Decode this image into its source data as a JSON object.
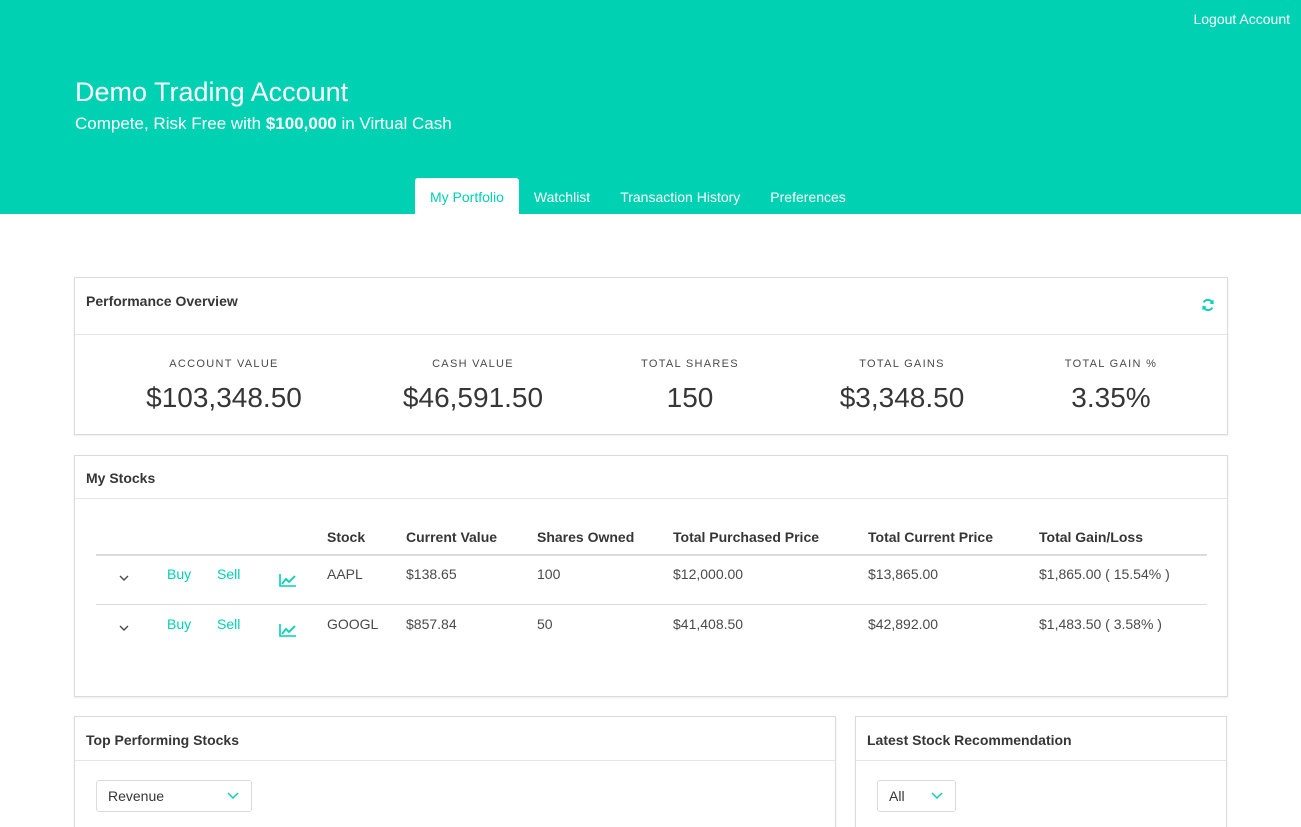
{
  "header": {
    "logout": "Logout Account",
    "title": "Demo Trading Account",
    "subtitle_pre": "Compete, Risk Free with ",
    "subtitle_amount": "$100,000",
    "subtitle_post": " in Virtual Cash",
    "accent_color": "#00d1b2"
  },
  "tabs": [
    {
      "label": "My Portfolio",
      "active": true
    },
    {
      "label": "Watchlist",
      "active": false
    },
    {
      "label": "Transaction History",
      "active": false
    },
    {
      "label": "Preferences",
      "active": false
    }
  ],
  "performance": {
    "title": "Performance Overview",
    "refresh_icon": "refresh-icon",
    "stats": [
      {
        "label": "ACCOUNT VALUE",
        "value": "$103,348.50"
      },
      {
        "label": "CASH VALUE",
        "value": "$46,591.50"
      },
      {
        "label": "TOTAL SHARES",
        "value": "150"
      },
      {
        "label": "TOTAL GAINS",
        "value": "$3,348.50"
      },
      {
        "label": "TOTAL GAIN %",
        "value": "3.35%"
      }
    ]
  },
  "stocks": {
    "title": "My Stocks",
    "columns": [
      "Stock",
      "Current Value",
      "Shares Owned",
      "Total Purchased Price",
      "Total Current Price",
      "Total Gain/Loss"
    ],
    "buy_label": "Buy",
    "sell_label": "Sell",
    "rows": [
      {
        "stock": "AAPL",
        "current_value": "$138.65",
        "shares": "100",
        "purchased": "$12,000.00",
        "current_total": "$13,865.00",
        "gain": "$1,865.00 ( 15.54% )"
      },
      {
        "stock": "GOOGL",
        "current_value": "$857.84",
        "shares": "50",
        "purchased": "$41,408.50",
        "current_total": "$42,892.00",
        "gain": "$1,483.50 ( 3.58% )"
      }
    ]
  },
  "top_performing": {
    "title": "Top Performing Stocks",
    "select_value": "Revenue"
  },
  "recommendation": {
    "title": "Latest Stock Recommendation",
    "select_value": "All"
  }
}
